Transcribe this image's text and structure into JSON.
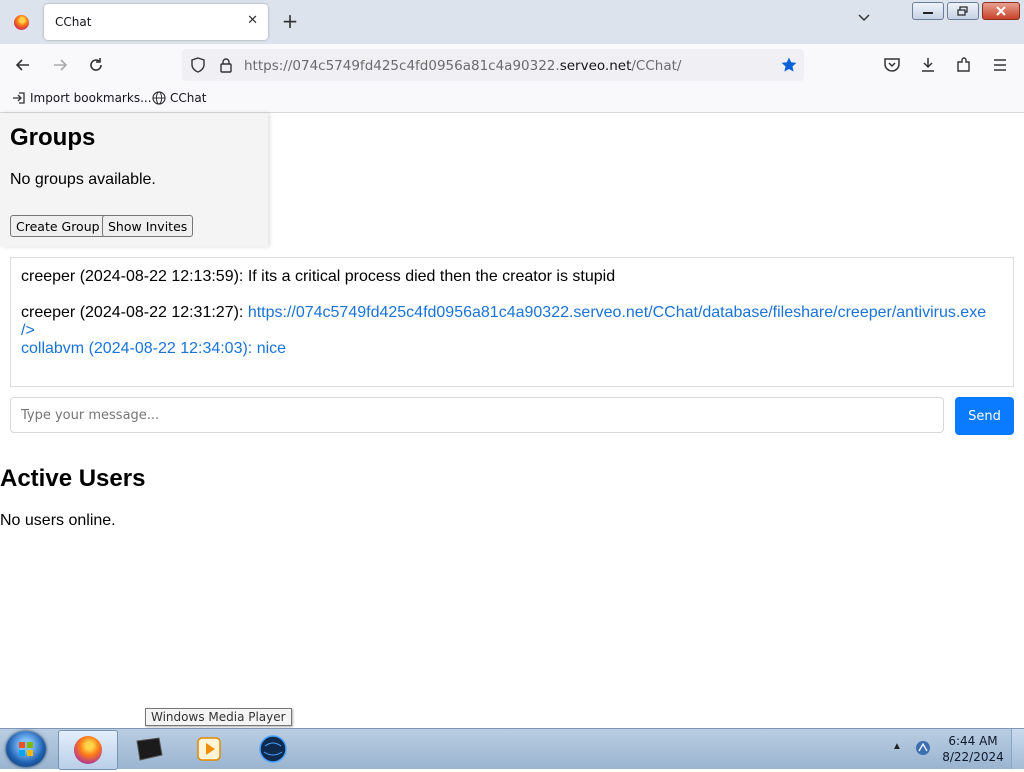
{
  "browser": {
    "tab_title": "CChat",
    "tab_close_glyph": "✕",
    "new_tab_glyph": "+",
    "url_prefix": "https://074c5749fd425c4fd0956a81c4a90322.",
    "url_domain": "serveo.net",
    "url_path": "/CChat/",
    "bookmarks": [
      {
        "label": "Import bookmarks...",
        "icon": "import-icon"
      },
      {
        "label": "CChat",
        "icon": "globe-icon"
      }
    ],
    "accent_color": "#0a7bff"
  },
  "groups": {
    "title": "Groups",
    "empty_text": "No groups available.",
    "create_label": "Create Group",
    "invites_label": "Show Invites"
  },
  "chat": {
    "messages": [
      {
        "meta": "creeper (2024-08-22 12:13:59): ",
        "text": "If its a critical process died then the creator is stupid"
      },
      {
        "meta": "creeper (2024-08-22 12:31:27): ",
        "link": "https://074c5749fd425c4fd0956a81c4a90322.serveo.net/CChat/database/fileshare/creeper/antivirus.exe",
        "link_tail": "/>"
      },
      {
        "meta": "collabvm (2024-08-22 12:34:03): nice"
      }
    ],
    "input_placeholder": "Type your message...",
    "send_label": "Send"
  },
  "users": {
    "title": "Active Users",
    "empty_text": "No users online."
  },
  "taskbar": {
    "tooltip": "Windows Media Player",
    "time": "6:44 AM",
    "date": "8/22/2024",
    "apps": [
      "firefox-icon",
      "terminal-icon",
      "media-player-icon",
      "globe-app-icon"
    ]
  }
}
